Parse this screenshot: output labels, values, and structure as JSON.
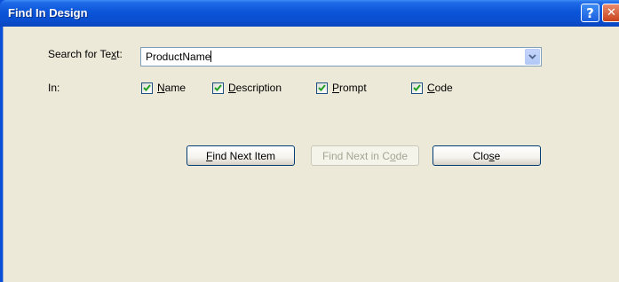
{
  "window": {
    "title": "Find In Design",
    "help_glyph": "?",
    "close_glyph": "✕"
  },
  "search": {
    "label_pre": "Search for Te",
    "label_mnemonic": "x",
    "label_post": "t:",
    "value": "ProductName"
  },
  "in_label": "In:",
  "checkboxes": [
    {
      "pre": "",
      "mnemonic": "N",
      "post": "ame",
      "checked": true
    },
    {
      "pre": "",
      "mnemonic": "D",
      "post": "escription",
      "checked": true
    },
    {
      "pre": "",
      "mnemonic": "P",
      "post": "rompt",
      "checked": true
    },
    {
      "pre": "",
      "mnemonic": "C",
      "post": "ode",
      "checked": true
    }
  ],
  "buttons": {
    "find_next": {
      "mnemonic": "F",
      "post": "ind Next Item",
      "enabled": true
    },
    "find_in_code": {
      "pre": "Find Next in C",
      "mnemonic": "o",
      "post": "de",
      "enabled": false
    },
    "close": {
      "pre": "Clo",
      "mnemonic": "s",
      "post": "e",
      "enabled": true
    }
  },
  "colors": {
    "titlebar": "#0a4fd0",
    "dialog_bg": "#ece9d8",
    "checkmark": "#21a121"
  }
}
